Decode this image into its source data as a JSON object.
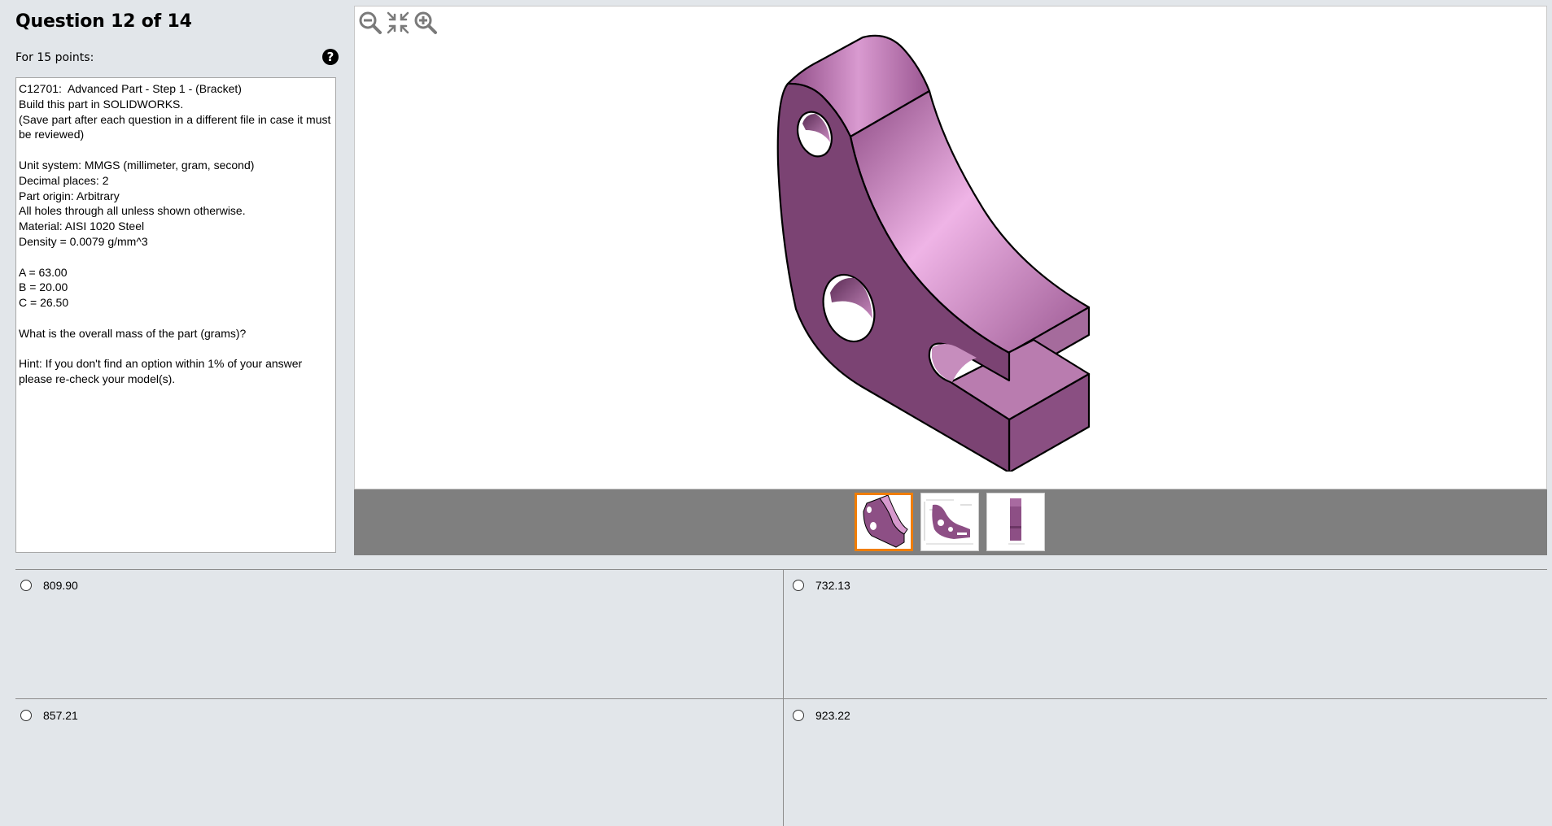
{
  "header": {
    "title": "Question 12 of 14",
    "points_label": "For 15 points:",
    "help_glyph": "?"
  },
  "question": {
    "lines": [
      "C12701:  Advanced Part - Step 1 - (Bracket)",
      "Build this part in SOLIDWORKS.",
      "(Save part after each question in a different file in case it must be reviewed)",
      "",
      "Unit system: MMGS (millimeter, gram, second)",
      "Decimal places: 2",
      "Part origin: Arbitrary",
      "All holes through all unless shown otherwise.",
      "Material: AISI 1020 Steel",
      "Density = 0.0079 g/mm^3",
      "",
      "A = 63.00",
      "B = 20.00",
      "C = 26.50",
      "",
      "What is the overall mass of the part (grams)?",
      "",
      "Hint: If you don't find an option within 1% of your answer please re-check your model(s)."
    ]
  },
  "viewer": {
    "tools": [
      {
        "name": "zoom-out-icon"
      },
      {
        "name": "fit-to-window-icon"
      },
      {
        "name": "zoom-in-icon"
      }
    ],
    "thumbnails": [
      {
        "name": "isometric-view",
        "selected": true
      },
      {
        "name": "drawing-view",
        "selected": false
      },
      {
        "name": "side-view",
        "selected": false
      }
    ],
    "part_color": "#9b5a92",
    "selected_thumb_border": "#f07d00"
  },
  "answers": [
    {
      "value": "809.90"
    },
    {
      "value": "732.13"
    },
    {
      "value": "857.21"
    },
    {
      "value": "923.22"
    }
  ]
}
